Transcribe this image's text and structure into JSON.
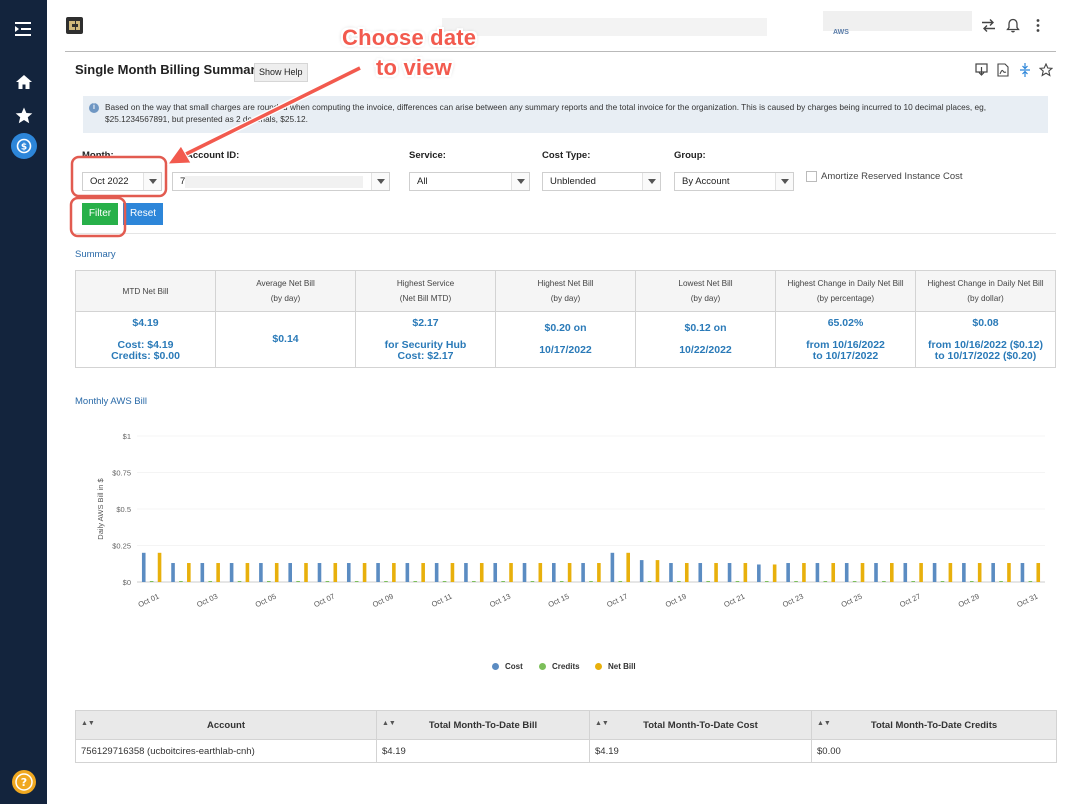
{
  "header": {
    "right_label": "AWS"
  },
  "page": {
    "title": "Single Month Billing Summary",
    "help_label": "Show Help"
  },
  "notice": "Based on the way that small charges are rounded when computing the invoice, differences can arise between any summary reports and the total invoice for the organization. This is caused by charges being incurred to 10 decimal places, eg, $25.1234567891, but presented as 2 decimals, $25.12.",
  "filters": {
    "month": {
      "label": "Month:",
      "value": "Oct 2022"
    },
    "account": {
      "label": "Account ID:",
      "value": "7"
    },
    "service": {
      "label": "Service:",
      "value": "All"
    },
    "cost_type": {
      "label": "Cost Type:",
      "value": "Unblended"
    },
    "group": {
      "label": "Group:",
      "value": "By Account"
    },
    "amortize_label": "Amortize Reserved Instance Cost",
    "filter_label": "Filter",
    "reset_label": "Reset"
  },
  "summary": {
    "label": "Summary",
    "headers": [
      "MTD Net Bill",
      "Average Net Bill\n(by day)",
      "Highest Service\n(Net Bill MTD)",
      "Highest Net Bill\n(by day)",
      "Lowest Net Bill\n(by day)",
      "Highest Change in Daily Net Bill\n(by percentage)",
      "Highest Change in Daily Net Bill\n(by dollar)"
    ],
    "values": [
      "$4.19\n\nCost: $4.19\nCredits: $0.00",
      "$0.14",
      "$2.17\n\nfor Security Hub\nCost: $2.17",
      "$0.20 on\n\n10/17/2022",
      "$0.12 on\n\n10/22/2022",
      "65.02%\n\nfrom 10/16/2022\nto 10/17/2022",
      "$0.08\n\nfrom 10/16/2022 ($0.12)\nto 10/17/2022 ($0.20)"
    ]
  },
  "chart_section_label": "Monthly AWS Bill",
  "chart_data": {
    "type": "bar",
    "ylabel": "Daily AWS Bill in $",
    "ylim": [
      0,
      1
    ],
    "yticks": [
      0,
      0.25,
      0.5,
      0.75,
      1
    ],
    "ytick_labels": [
      "$0",
      "$0.25",
      "$0.5",
      "$0.75",
      "$1"
    ],
    "categories": [
      "Oct 01",
      "Oct 02",
      "Oct 03",
      "Oct 04",
      "Oct 05",
      "Oct 06",
      "Oct 07",
      "Oct 08",
      "Oct 09",
      "Oct 10",
      "Oct 11",
      "Oct 12",
      "Oct 13",
      "Oct 14",
      "Oct 15",
      "Oct 16",
      "Oct 17",
      "Oct 18",
      "Oct 19",
      "Oct 20",
      "Oct 21",
      "Oct 22",
      "Oct 23",
      "Oct 24",
      "Oct 25",
      "Oct 26",
      "Oct 27",
      "Oct 28",
      "Oct 29",
      "Oct 30",
      "Oct 31"
    ],
    "tick_labels": [
      "Oct 01",
      "Oct 03",
      "Oct 05",
      "Oct 07",
      "Oct 09",
      "Oct 11",
      "Oct 13",
      "Oct 15",
      "Oct 17",
      "Oct 19",
      "Oct 21",
      "Oct 23",
      "Oct 25",
      "Oct 27",
      "Oct 29",
      "Oct 31"
    ],
    "series": [
      {
        "name": "Cost",
        "color": "#5b8cc2",
        "values": [
          0.2,
          0.13,
          0.13,
          0.13,
          0.13,
          0.13,
          0.13,
          0.13,
          0.13,
          0.13,
          0.13,
          0.13,
          0.13,
          0.13,
          0.13,
          0.13,
          0.2,
          0.15,
          0.13,
          0.13,
          0.13,
          0.12,
          0.13,
          0.13,
          0.13,
          0.13,
          0.13,
          0.13,
          0.13,
          0.13,
          0.13
        ]
      },
      {
        "name": "Credits",
        "color": "#7cbf5a",
        "values": [
          0,
          0,
          0,
          0,
          0,
          0,
          0,
          0,
          0,
          0,
          0,
          0,
          0,
          0,
          0,
          0,
          0,
          0,
          0,
          0,
          0,
          0,
          0,
          0,
          0,
          0,
          0,
          0,
          0,
          0,
          0
        ]
      },
      {
        "name": "Net Bill",
        "color": "#e8b00c",
        "values": [
          0.2,
          0.13,
          0.13,
          0.13,
          0.13,
          0.13,
          0.13,
          0.13,
          0.13,
          0.13,
          0.13,
          0.13,
          0.13,
          0.13,
          0.13,
          0.13,
          0.2,
          0.15,
          0.13,
          0.13,
          0.13,
          0.12,
          0.13,
          0.13,
          0.13,
          0.13,
          0.13,
          0.13,
          0.13,
          0.13,
          0.13
        ]
      }
    ]
  },
  "accounts": {
    "headers": [
      "Account",
      "Total Month-To-Date Bill",
      "Total Month-To-Date Cost",
      "Total Month-To-Date Credits"
    ],
    "rows": [
      [
        "756129716358 (ucboitcires-earthlab-cnh)",
        "$4.19",
        "$4.19",
        "$0.00"
      ]
    ]
  },
  "annotation": {
    "line1": "Choose date",
    "line2": "to view",
    "color": "#f25a4e"
  }
}
